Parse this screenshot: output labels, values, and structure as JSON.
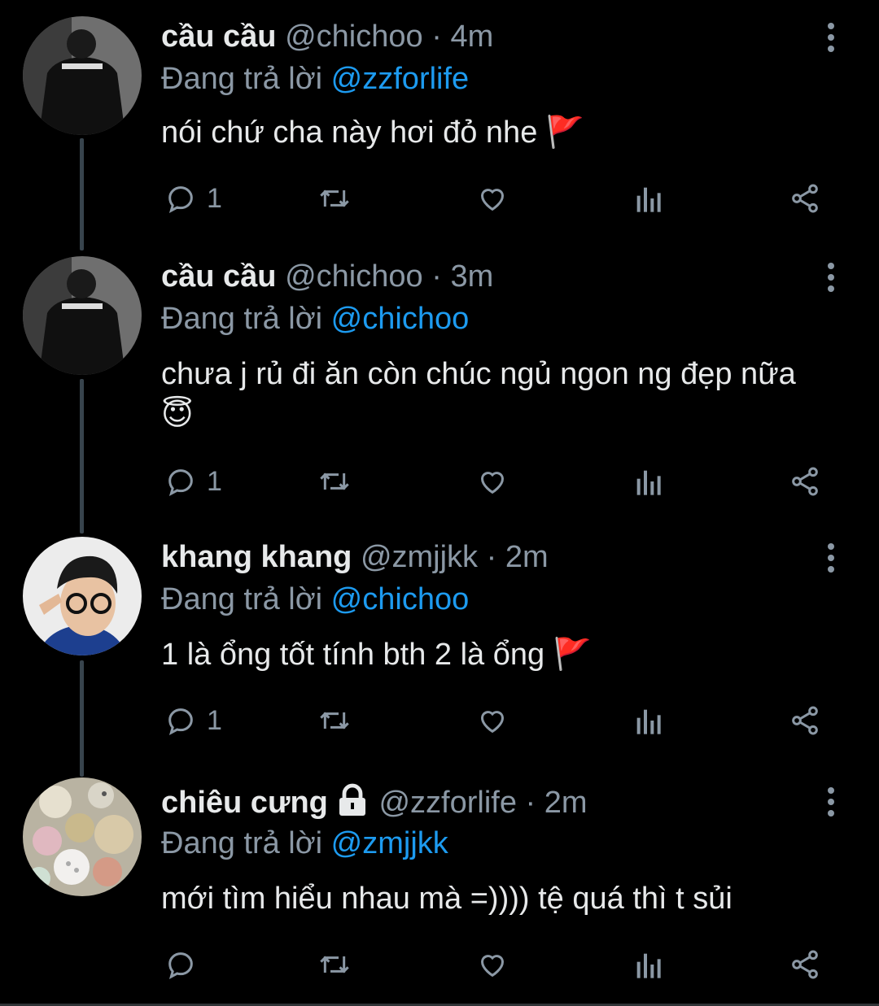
{
  "tweets": [
    {
      "name": "cầu cầu",
      "handle": "@chichoo",
      "separator": "·",
      "time": "4m",
      "reply_prefix": "Đang trả lời",
      "reply_to": "@zzforlife",
      "text": "nói chứ cha này hơi đỏ nhe",
      "emoji": "🚩",
      "replies": "1",
      "avatar_icon": "person-in-black-shirt-avatar"
    },
    {
      "name": "cầu cầu",
      "handle": "@chichoo",
      "separator": "·",
      "time": "3m",
      "reply_prefix": "Đang trả lời",
      "reply_to": "@chichoo",
      "text": "chưa j rủ đi ăn còn chúc ngủ ngon ng đẹp nữa",
      "emoji": "😇",
      "replies": "1",
      "avatar_icon": "person-in-black-shirt-avatar"
    },
    {
      "name": "khang khang",
      "handle": "@zmjjkk",
      "separator": "·",
      "time": "2m",
      "reply_prefix": "Đang trả lời",
      "reply_to": "@chichoo",
      "text": "1 là ổng tốt tính bth 2 là ổng",
      "emoji": "🚩",
      "replies": "1",
      "avatar_icon": "man-with-glasses-avatar"
    },
    {
      "name": "chiêu cưng",
      "handle": "@zzforlife",
      "separator": "·",
      "time": "2m",
      "reply_prefix": "Đang trả lời",
      "reply_to": "@zmjjkk",
      "text": "mới tìm hiểu nhau mà =)))) tệ quá thì t sủi",
      "emoji": "",
      "replies": "",
      "avatar_icon": "buttons-photo-avatar",
      "locked": true
    }
  ],
  "colors": {
    "background": "#000000",
    "text": "#e7e9ea",
    "muted": "#8b98a5",
    "mention": "#1d9bf0",
    "thread_line": "#38444d"
  },
  "icons": [
    "reply-icon",
    "retweet-icon",
    "like-icon",
    "views-icon",
    "share-icon",
    "more-icon",
    "lock-icon",
    "red-flag-emoji",
    "halo-smile-emoji"
  ]
}
